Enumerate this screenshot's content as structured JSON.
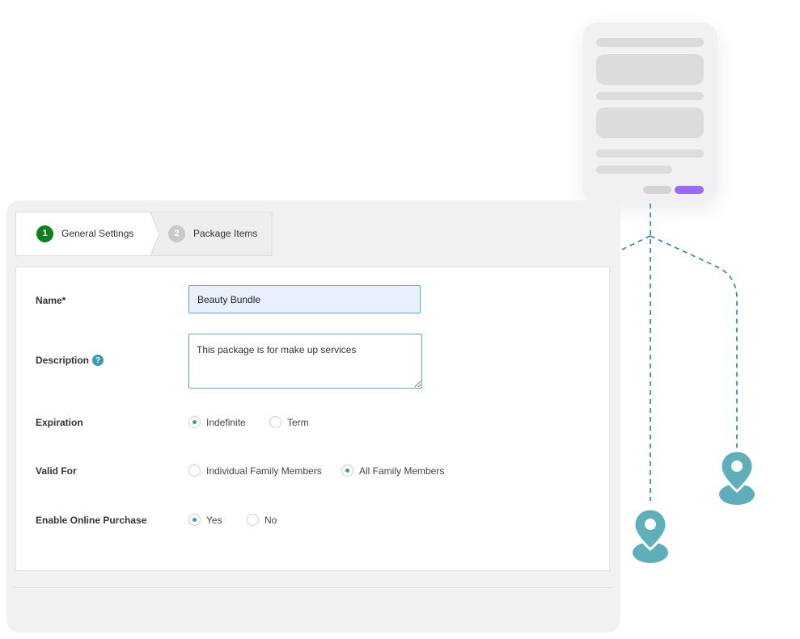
{
  "tabs": [
    {
      "number": "1",
      "label": "General Settings",
      "active": true
    },
    {
      "number": "2",
      "label": "Package Items",
      "active": false
    }
  ],
  "form": {
    "name": {
      "label": "Name*",
      "value": "Beauty Bundle"
    },
    "description": {
      "label": "Description",
      "value": "This package is for make up services"
    },
    "expiration": {
      "label": "Expiration",
      "options": [
        "Indefinite",
        "Term"
      ],
      "selected": "Indefinite"
    },
    "valid_for": {
      "label": "Valid For",
      "options": [
        "Individual Family Members",
        "All Family Members"
      ],
      "selected": "All Family Members"
    },
    "online_purchase": {
      "label": "Enable Online Purchase",
      "options": [
        "Yes",
        "No"
      ],
      "selected": "Yes"
    }
  },
  "colors": {
    "active_step": "#0e7f1f",
    "inactive_step": "#c9c9c9",
    "accent": "#3b9ab2",
    "pin": "#5fafbb",
    "phone_button": "#9b6af2"
  },
  "icons": {
    "help": "question-circle-icon",
    "location": "location-pin-icon"
  }
}
